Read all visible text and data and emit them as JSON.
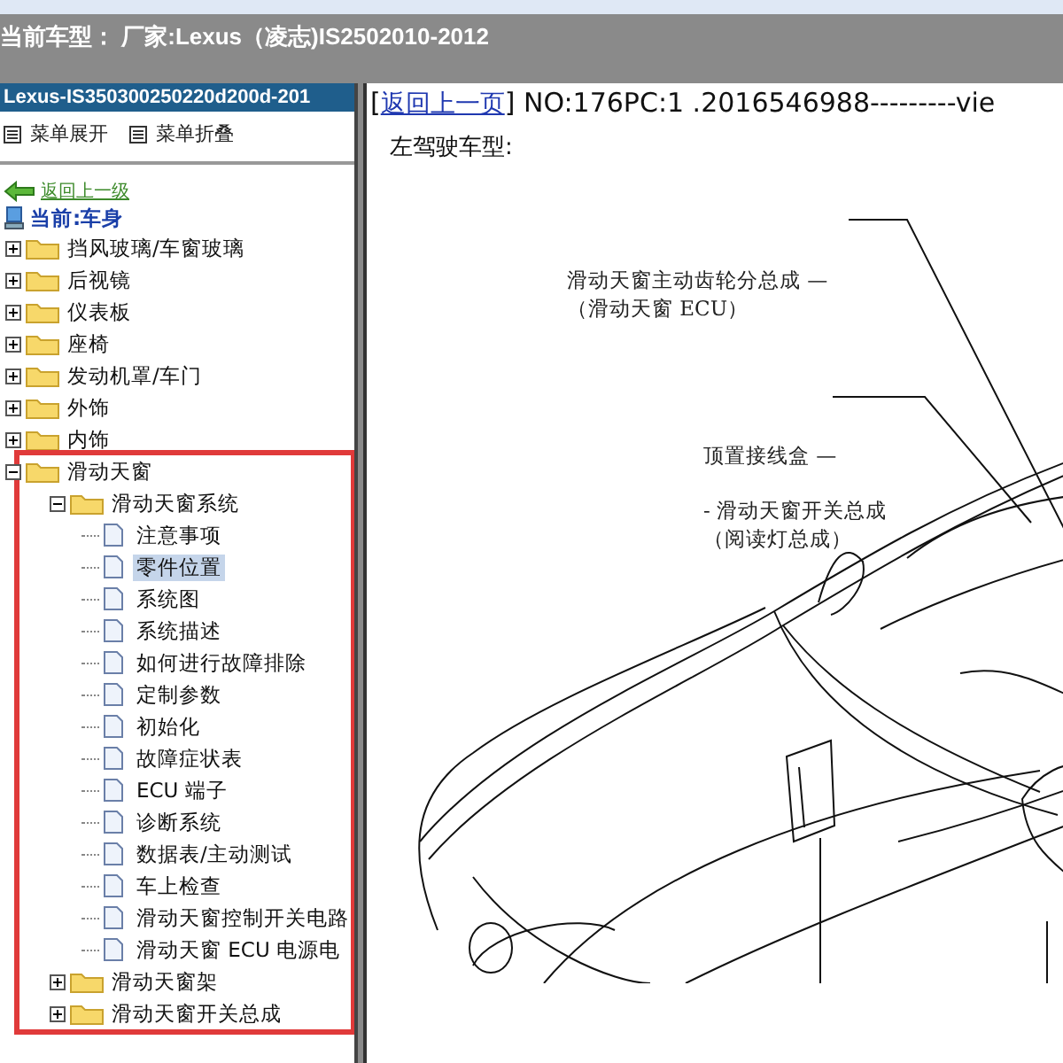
{
  "header": {
    "title": "当前车型： 厂家:Lexus（凌志)IS2502010-2012"
  },
  "sidebar": {
    "title": "Lexus-IS350300250220d200d-201",
    "menu_buttons": [
      "菜单展开",
      "菜单折叠"
    ],
    "back_link": "返回上一级",
    "current": "当前:车身",
    "tree": [
      {
        "label": "挡风玻璃/车窗玻璃",
        "kind": "folder",
        "expanded": false
      },
      {
        "label": "后视镜",
        "kind": "folder",
        "expanded": false
      },
      {
        "label": "仪表板",
        "kind": "folder",
        "expanded": false
      },
      {
        "label": "座椅",
        "kind": "folder",
        "expanded": false
      },
      {
        "label": "发动机罩/车门",
        "kind": "folder",
        "expanded": false
      },
      {
        "label": "外饰",
        "kind": "folder",
        "expanded": false
      },
      {
        "label": "内饰",
        "kind": "folder",
        "expanded": false
      },
      {
        "label": "滑动天窗",
        "kind": "folder",
        "expanded": true,
        "highlighted": true,
        "children": [
          {
            "label": "滑动天窗系统",
            "kind": "folder",
            "expanded": true,
            "children": [
              {
                "label": "注意事项",
                "kind": "page",
                "selected": false
              },
              {
                "label": "零件位置",
                "kind": "page",
                "selected": true
              },
              {
                "label": "系统图",
                "kind": "page",
                "selected": false
              },
              {
                "label": "系统描述",
                "kind": "page",
                "selected": false
              },
              {
                "label": "如何进行故障排除",
                "kind": "page",
                "selected": false
              },
              {
                "label": "定制参数",
                "kind": "page",
                "selected": false
              },
              {
                "label": "初始化",
                "kind": "page",
                "selected": false
              },
              {
                "label": "故障症状表",
                "kind": "page",
                "selected": false
              },
              {
                "label": "ECU 端子",
                "kind": "page",
                "selected": false
              },
              {
                "label": "诊断系统",
                "kind": "page",
                "selected": false
              },
              {
                "label": "数据表/主动测试",
                "kind": "page",
                "selected": false
              },
              {
                "label": "车上检查",
                "kind": "page",
                "selected": false
              },
              {
                "label": "滑动天窗控制开关电路",
                "kind": "page",
                "selected": false
              },
              {
                "label": "滑动天窗 ECU 电源电",
                "kind": "page",
                "selected": false
              }
            ]
          },
          {
            "label": "滑动天窗架",
            "kind": "folder",
            "expanded": false
          },
          {
            "label": "滑动天窗开关总成",
            "kind": "folder",
            "expanded": false
          }
        ]
      }
    ]
  },
  "content": {
    "bracket_open": "[",
    "back_link": "返回上一页",
    "doc_info": "] NO:176PC:1 .2016546988---------vie",
    "heading": "左驾驶车型:",
    "callouts": [
      {
        "lines": [
          "滑动天窗主动齿轮分总成 —",
          "（滑动天窗 ECU）"
        ]
      },
      {
        "lines": [
          "顶置接线盒 —"
        ]
      },
      {
        "lines": [
          "- 滑动天窗开关总成",
          "（阅读灯总成）"
        ]
      }
    ]
  }
}
